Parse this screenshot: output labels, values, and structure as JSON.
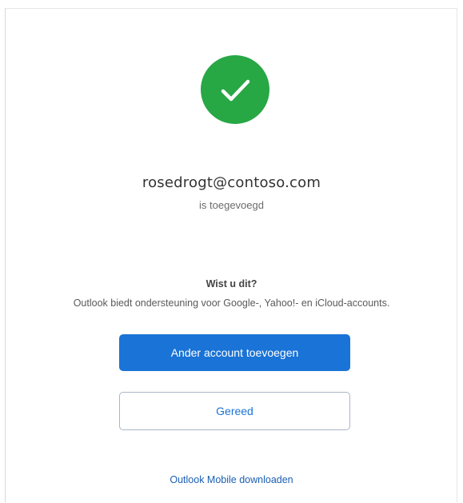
{
  "status": {
    "icon": "checkmark-icon",
    "color": "#28a745"
  },
  "account": {
    "email": "rosedrogt@contoso.com",
    "status_text": "is toegevoegd"
  },
  "tip": {
    "title": "Wist u dit?",
    "body": "Outlook biedt ondersteuning voor Google-, Yahoo!- en iCloud-accounts."
  },
  "actions": {
    "add_account_label": "Ander account toevoegen",
    "done_label": "Gereed",
    "download_link": "Outlook Mobile downloaden"
  },
  "colors": {
    "primary": "#1a73d6",
    "success": "#28a745"
  }
}
